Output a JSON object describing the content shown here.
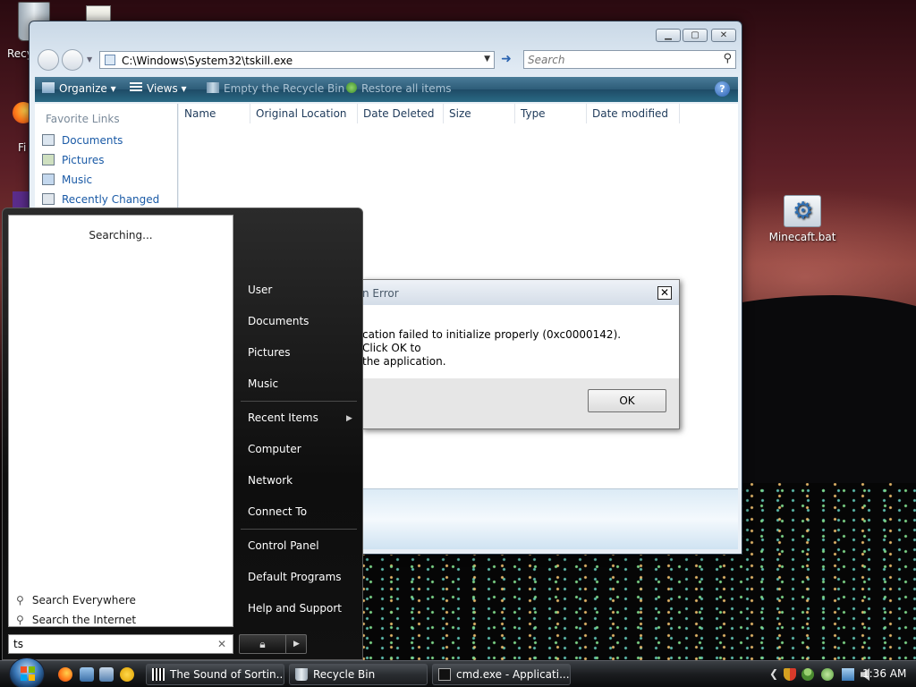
{
  "desktop": {
    "icons": {
      "minecraft_label": "Minecaft.bat",
      "recycle_label": "Recy",
      "firefox_label": "Fi"
    }
  },
  "explorer": {
    "address": "C:\\Windows\\System32\\tskill.exe",
    "search_placeholder": "Search",
    "toolbar": {
      "organize": "Organize",
      "views": "Views",
      "empty_recycle_bin": "Empty the Recycle Bin",
      "restore_all": "Restore all items"
    },
    "favorite_links": {
      "heading": "Favorite Links",
      "items": [
        "Documents",
        "Pictures",
        "Music",
        "Recently Changed"
      ]
    },
    "columns": [
      "Name",
      "Original Location",
      "Date Deleted",
      "Size",
      "Type",
      "Date modified"
    ]
  },
  "error_dialog": {
    "title": "n Error",
    "message_line1": "cation failed to initialize properly (0xc0000142). Click OK to",
    "message_line2": " the application.",
    "ok_label": "OK"
  },
  "start_menu": {
    "searching": "Searching...",
    "search_everywhere": "Search Everywhere",
    "search_internet": "Search the Internet",
    "search_value": "ts",
    "right_items": {
      "user": "User",
      "documents": "Documents",
      "pictures": "Pictures",
      "music": "Music",
      "recent_items": "Recent Items",
      "computer": "Computer",
      "network": "Network",
      "connect_to": "Connect To",
      "control_panel": "Control Panel",
      "default_programs": "Default Programs",
      "help_support": "Help and Support"
    }
  },
  "taskbar": {
    "tasks": [
      "The Sound of Sortin...",
      "Recycle Bin",
      "cmd.exe - Applicati..."
    ],
    "clock": "1:36 AM"
  }
}
